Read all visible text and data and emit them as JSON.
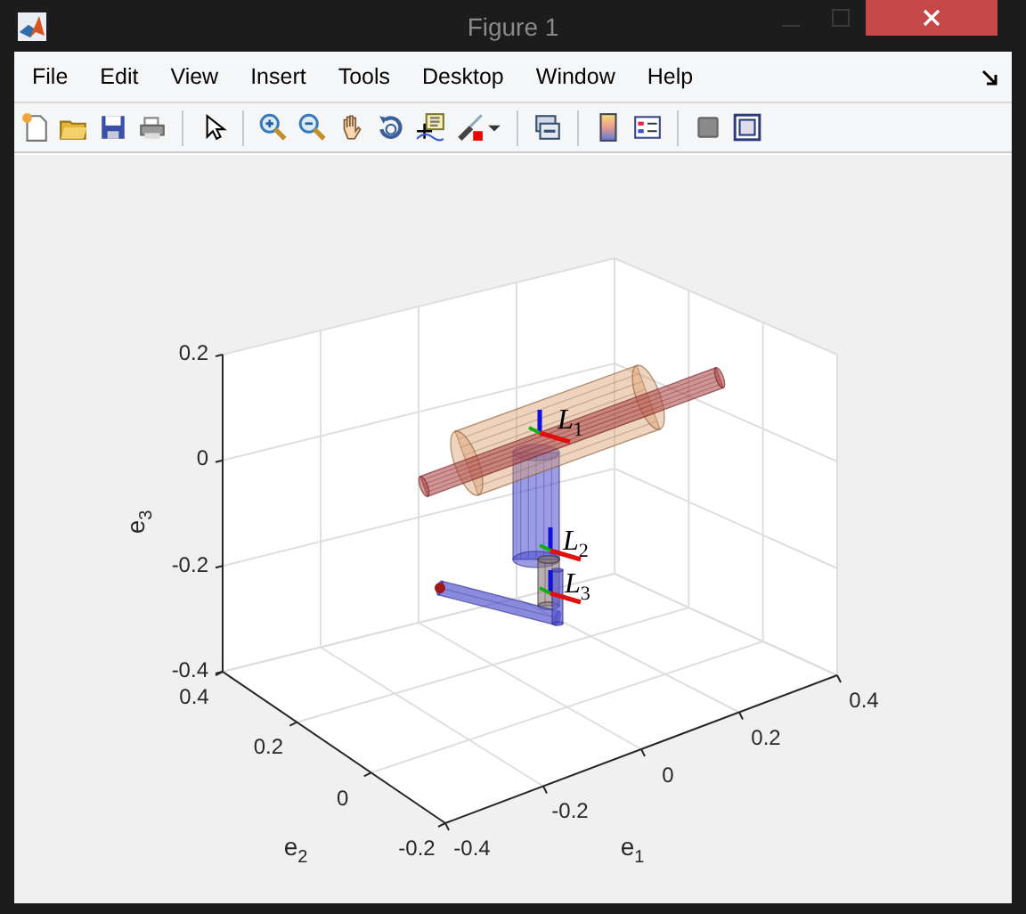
{
  "window": {
    "title": "Figure 1"
  },
  "menu": [
    {
      "label": "File"
    },
    {
      "label": "Edit"
    },
    {
      "label": "View"
    },
    {
      "label": "Insert"
    },
    {
      "label": "Tools"
    },
    {
      "label": "Desktop"
    },
    {
      "label": "Window"
    },
    {
      "label": "Help"
    }
  ],
  "plot": {
    "xlabel": "e$_{1}$",
    "ylabel": "e$_{2}$",
    "zlabel": "e$_{3}$",
    "xticks": [
      "-0.4",
      "-0.2",
      "0",
      "0.2",
      "0.4"
    ],
    "yticks": [
      "0.4",
      "0.2",
      "0",
      "-0.2"
    ],
    "zticks": [
      "0.2",
      "0",
      "-0.2",
      "-0.4"
    ],
    "link_labels": [
      "L$_{1}$",
      "L$_{2}$",
      "L$_{3}$"
    ]
  }
}
